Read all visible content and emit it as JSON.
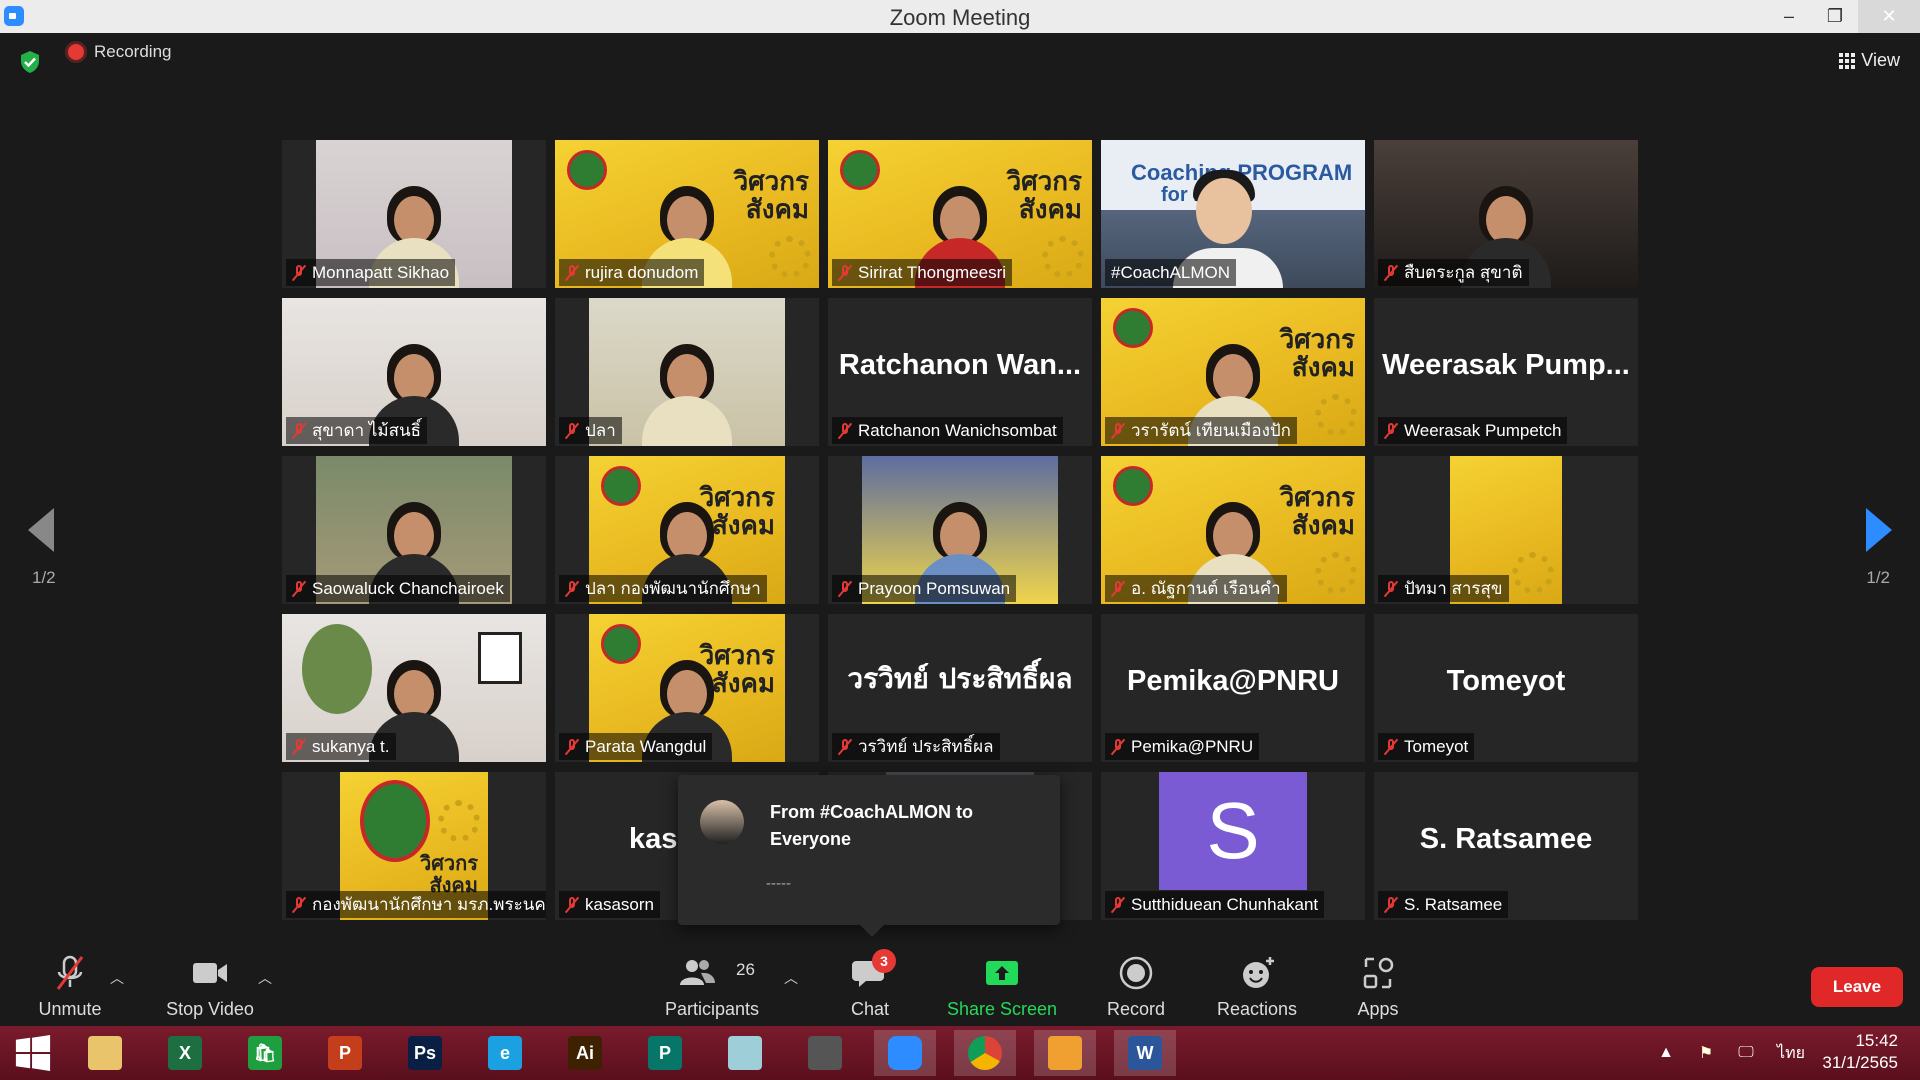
{
  "window": {
    "title": "Zoom Meeting",
    "minimize": "–",
    "restore": "❐",
    "close": "✕"
  },
  "topbar": {
    "recording_label": "Recording",
    "view_label": "View"
  },
  "pagination": {
    "left": "1/2",
    "right": "1/2"
  },
  "tiles": [
    {
      "name": "Monnapatt Sikhao"
    },
    {
      "name": "rujira donudom"
    },
    {
      "name": "Sirirat Thongmeesri"
    },
    {
      "name": "#CoachALMON",
      "banner1": "Coaching PROGRAM",
      "banner2": "for    r"
    },
    {
      "name": "สืบตระกูล สุขาติ"
    },
    {
      "name": "สุขาดา ไม้สนธิ์"
    },
    {
      "name": "ปลา"
    },
    {
      "name": "Ratchanon Wanichsombat",
      "display": "Ratchanon  Wan..."
    },
    {
      "name": "วรารัตน์ เทียนเมืองปัก"
    },
    {
      "name": "Weerasak Pumpetch",
      "display": "Weerasak  Pump..."
    },
    {
      "name": "Saowaluck Chanchairoek"
    },
    {
      "name": "ปลา กองพัฒนานักศึกษา"
    },
    {
      "name": "Prayoon Pomsuwan"
    },
    {
      "name": "อ. ณัฐกานต์ เรือนคำ"
    },
    {
      "name": "ปัทมา สารสุข"
    },
    {
      "name": "sukanya t."
    },
    {
      "name": "Parata Wangdul"
    },
    {
      "name": "วรวิทย์ ประสิทธิ์ผล",
      "display": "วรวิทย์ ประสิทธิ์ผล"
    },
    {
      "name": "Pemika@PNRU",
      "display": "Pemika@PNRU"
    },
    {
      "name": "Tomeyot",
      "display": "Tomeyot"
    },
    {
      "name": "กองพัฒนานักศึกษา มรภ.พระนคร"
    },
    {
      "name": "kasasorn",
      "display": "kasa"
    },
    {
      "name": ""
    },
    {
      "name": "Sutthiduean Chunhakant",
      "initial": "S"
    },
    {
      "name": "S. Ratsamee",
      "display": "S. Ratsamee"
    }
  ],
  "poster_text": {
    "line1": "วิศวกร",
    "line2": "สังคม"
  },
  "chat_popup": {
    "from": "From #CoachALMON to Everyone",
    "message": "-----"
  },
  "toolbar": {
    "unmute": "Unmute",
    "stop_video": "Stop Video",
    "participants": "Participants",
    "participants_count": "26",
    "chat": "Chat",
    "chat_badge": "3",
    "share_screen": "Share Screen",
    "record": "Record",
    "reactions": "Reactions",
    "apps": "Apps",
    "leave": "Leave"
  },
  "taskbar": {
    "apps": [
      {
        "icon": "folder-icon",
        "label": "",
        "color": "#e9c46a"
      },
      {
        "icon": "excel-icon",
        "label": "X",
        "color": "#1d6f42"
      },
      {
        "icon": "store-icon",
        "label": "🛍",
        "color": "#1e9e3e"
      },
      {
        "icon": "powerpoint-icon",
        "label": "P",
        "color": "#c43e1c"
      },
      {
        "icon": "photoshop-icon",
        "label": "Ps",
        "color": "#0a1f44"
      },
      {
        "icon": "ie-icon",
        "label": "e",
        "color": "#1ba1e2"
      },
      {
        "icon": "illustrator-icon",
        "label": "Ai",
        "color": "#3d2100"
      },
      {
        "icon": "publisher-icon",
        "label": "P",
        "color": "#077568"
      },
      {
        "icon": "eraser-icon",
        "label": "",
        "color": "#9ecfd9"
      },
      {
        "icon": "photoscape-icon",
        "label": "",
        "color": "#555555"
      },
      {
        "icon": "zoom-icon",
        "label": "",
        "color": "#2d8cff"
      },
      {
        "icon": "chrome-icon",
        "label": "",
        "color": "#ffffff"
      },
      {
        "icon": "video-app-icon",
        "label": "",
        "color": "#f0a030"
      },
      {
        "icon": "word-icon",
        "label": "W",
        "color": "#2b579a"
      }
    ],
    "language": "ไทย",
    "time": "15:42",
    "date": "31/1/2565"
  }
}
